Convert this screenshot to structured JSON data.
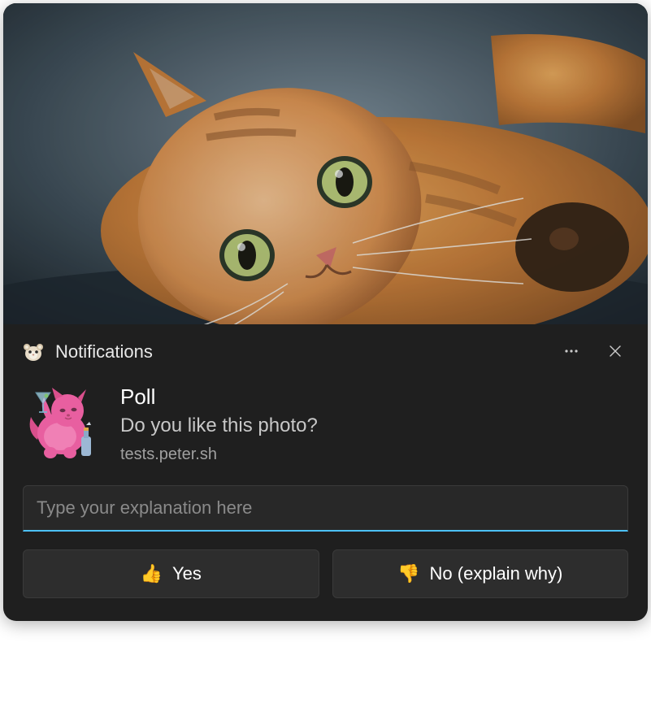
{
  "header": {
    "app_name": "Notifications"
  },
  "body": {
    "title": "Poll",
    "message": "Do you like this photo?",
    "source": "tests.peter.sh"
  },
  "input": {
    "placeholder": "Type your explanation here",
    "value": ""
  },
  "actions": {
    "yes": {
      "emoji": "👍",
      "label": "Yes"
    },
    "no": {
      "emoji": "👎",
      "label": "No (explain why)"
    }
  },
  "icons": {
    "more": "more-icon",
    "close": "close-icon",
    "app": "hamster-icon",
    "avatar": "pink-cat-martini-icon",
    "hero": "orange-cat-photo"
  }
}
